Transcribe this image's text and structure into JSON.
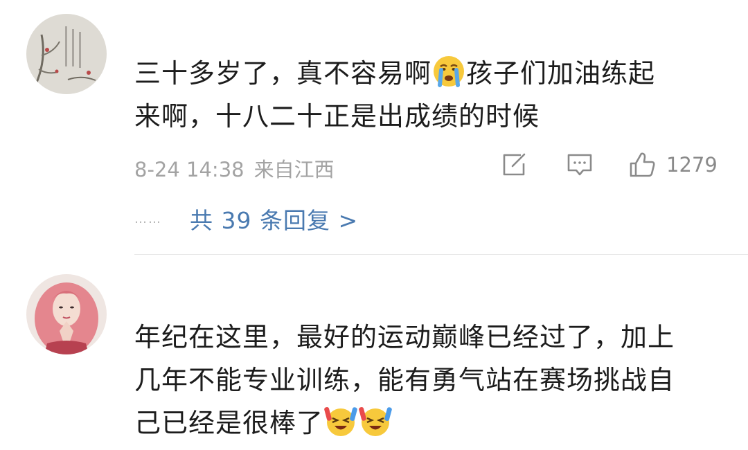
{
  "comments": [
    {
      "avatar": "ink-painting-avatar",
      "line1_a": "三十多岁了，真不容易啊",
      "emoji1": "crying-face-emoji",
      "line1_b": "孩子们加油练起",
      "line2": "来啊，十八二十正是出成绩的时候",
      "date": "8-24 14:38",
      "location": "来自江西",
      "actions": {
        "share_icon": "share-edit-icon",
        "comment_icon": "comment-bubble-icon",
        "like_icon": "thumbs-up-icon",
        "like_count": "1279"
      },
      "replies_dots": "……",
      "replies_link": "共 39 条回复 >"
    },
    {
      "avatar": "pink-hair-portrait-avatar",
      "line1": "年纪在这里，最好的运动巅峰已经过了，加上",
      "line2": "几年不能专业训练，能有勇气站在赛场挑战自",
      "line3": "己已经是很棒了",
      "emoji_a": "cheering-face-emoji",
      "emoji_b": "cheering-face-emoji"
    }
  ],
  "colors": {
    "text": "#1c1c1c",
    "meta": "#a3a3a3",
    "link": "#4a7ab0",
    "divider": "#e6e6e6"
  }
}
